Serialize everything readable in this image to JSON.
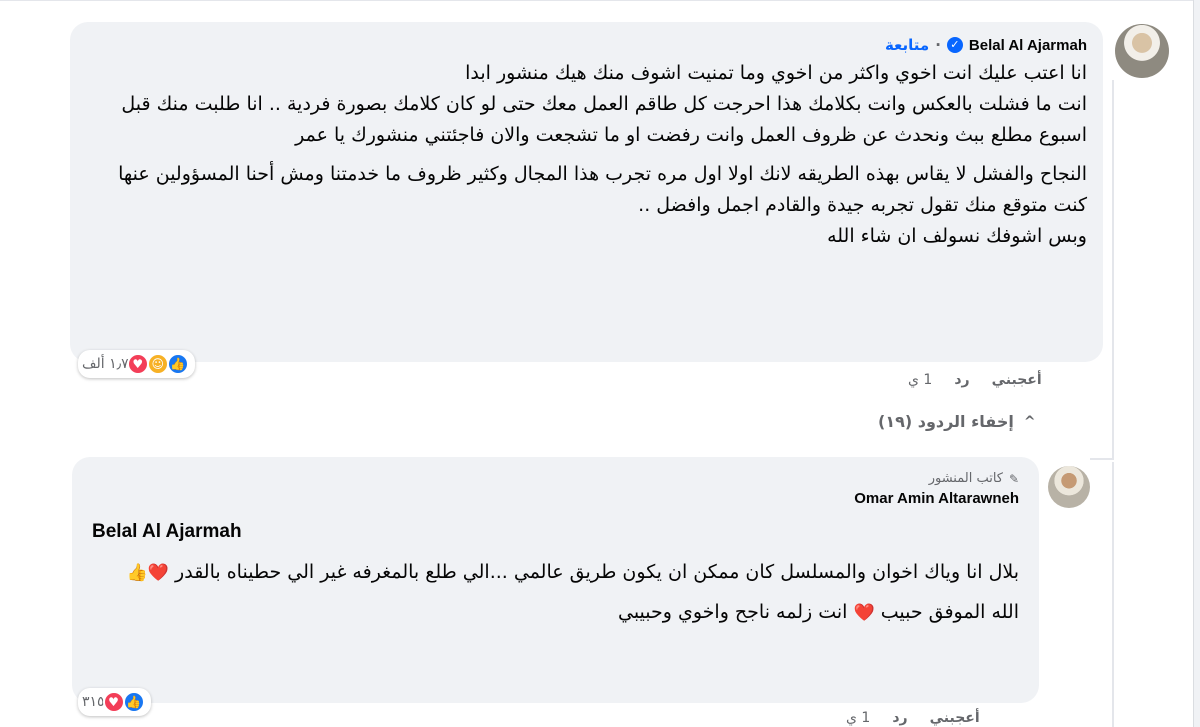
{
  "colors": {
    "bubble_bg": "#f0f2f5",
    "link": "#0866ff",
    "meta": "#65676b",
    "like": "#1877f2",
    "love": "#f33e58"
  },
  "comment1": {
    "author": "Belal Al Ajarmah",
    "follow_label": "متابعة",
    "dot": "·",
    "paragraphs": [
      "انا اعتب عليك انت اخوي واكثر من اخوي وما تمنيت اشوف منك هيك منشور ابدا\nانت ما فشلت بالعكس وانت بكلامك هذا احرجت كل طاقم العمل معك حتى لو كان كلامك بصورة فردية .. انا طلبت منك قبل اسبوع مطلع ببث ونحدث عن ظروف العمل وانت رفضت او ما تشجعت والان فاجئتني منشورك يا عمر",
      "النجاح والفشل لا يقاس بهذه الطريقه لانك اولا اول مره تجرب هذا المجال وكثير ظروف ما خدمتنا ومش أحنا المسؤولين عنها\nكنت متوقع منك تقول تجربه جيدة والقادم اجمل وافضل ..\nوبس اشوفك نسولف ان شاء الله"
    ],
    "reaction_count": "١٫٧ ألف",
    "actions": {
      "like": "أعجبني",
      "reply": "رد",
      "time": "1 ي"
    }
  },
  "hide_replies": "إخفاء الردود (١٩)",
  "comment2": {
    "author_tag": "كاتب المنشور",
    "author": "Omar Amin Altarawneh",
    "mention": "Belal Al Ajarmah",
    "paragraphs": [
      "بلال انا وياك اخوان والمسلسل كان ممكن ان يكون طريق عالمي ...الي طلع بالمغرفه غير الي حطيناه بالقدر",
      "الله الموفق حبيب",
      "انت زلمه ناجح واخوي وحبيبي"
    ],
    "emoji_heart": "❤️",
    "emoji_thumb": "👍",
    "reaction_count": "٣١٥",
    "actions": {
      "like": "أعجبني",
      "reply": "رد",
      "time": "1 ي"
    }
  },
  "icons": {
    "verified": "verified-badge-icon",
    "pen": "pen-icon",
    "chevron": "chevron-up-icon"
  }
}
